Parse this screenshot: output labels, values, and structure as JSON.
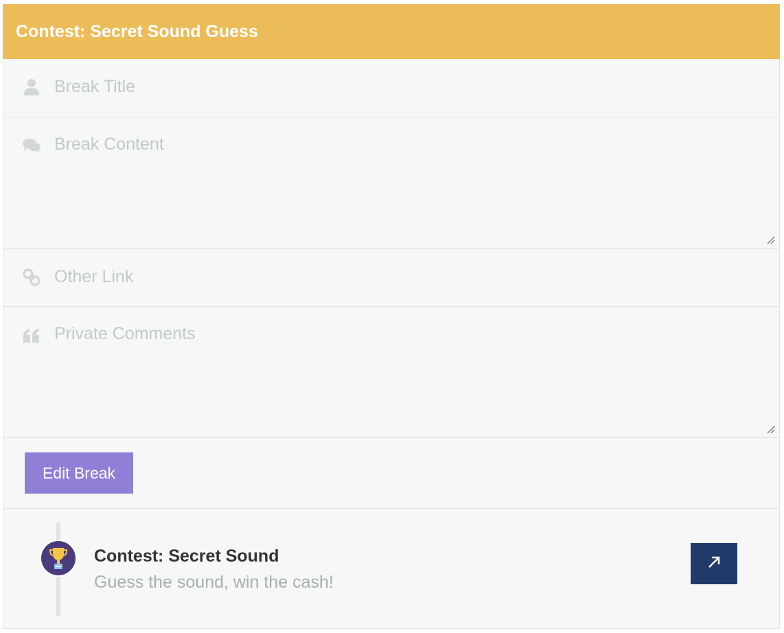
{
  "header": {
    "title": "Contest: Secret Sound Guess"
  },
  "form": {
    "break_title": {
      "placeholder": "Break Title",
      "icon": "user-icon"
    },
    "break_content": {
      "placeholder": "Break Content",
      "icon": "comments-icon"
    },
    "other_link": {
      "placeholder": "Other Link",
      "icon": "link-icon"
    },
    "private_comments": {
      "placeholder": "Private Comments",
      "icon": "quote-icon"
    },
    "submit_label": "Edit Break"
  },
  "item": {
    "title": "Contest: Secret Sound",
    "subtitle": "Guess the sound, win the cash!",
    "icon": "trophy-icon",
    "action_icon": "arrow-up-right-icon"
  },
  "colors": {
    "header": "#ecbc58",
    "button": "#917ed6",
    "action": "#223a6a",
    "avatar": "#4a3b7c"
  }
}
